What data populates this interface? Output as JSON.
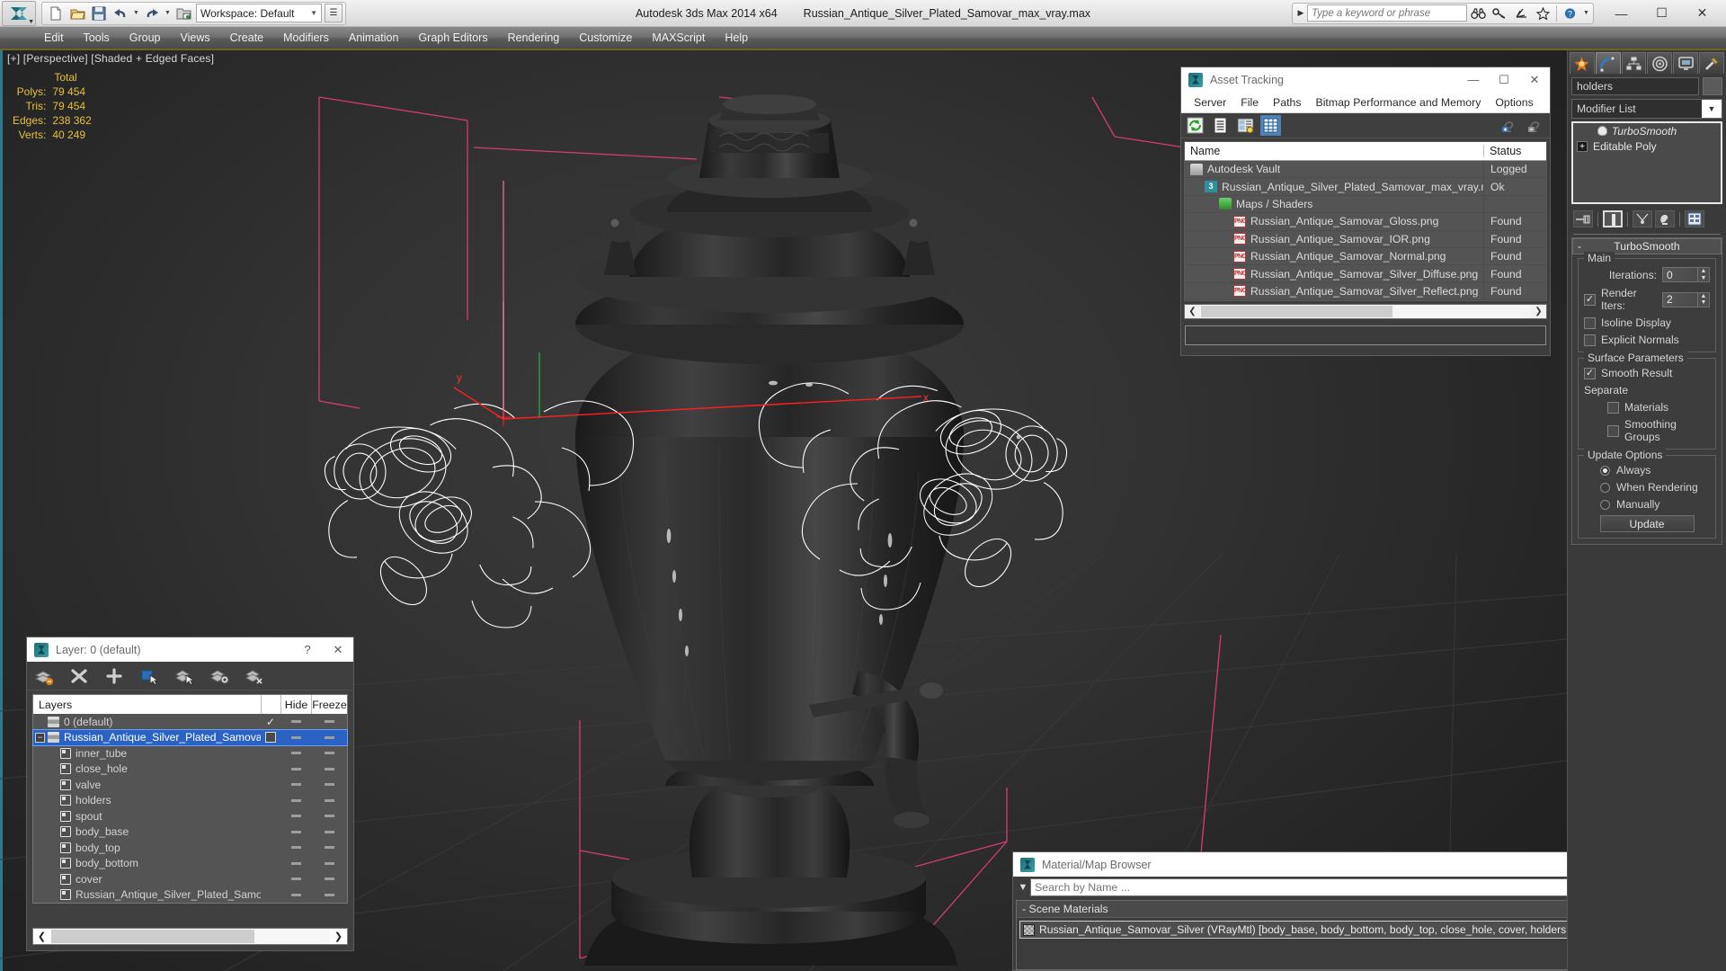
{
  "app": {
    "title": "Autodesk 3ds Max  2014 x64",
    "file_title": "Russian_Antique_Silver_Plated_Samovar_max_vray.max",
    "workspace_label": "Workspace: Default"
  },
  "quick_access": {
    "items": [
      {
        "name": "new-file-icon",
        "glyph": "new"
      },
      {
        "name": "open-file-icon",
        "glyph": "open"
      },
      {
        "name": "save-file-icon",
        "glyph": "save"
      },
      {
        "name": "undo-icon",
        "glyph": "undo"
      },
      {
        "name": "redo-icon",
        "glyph": "redo"
      },
      {
        "name": "set-project-folder-icon",
        "glyph": "project"
      }
    ]
  },
  "infocenter": {
    "placeholder": "Type a keyword or phrase",
    "icons": [
      "binoculars-icon",
      "key-icon",
      "subscription-icon",
      "favorites-star-icon",
      "help-icon"
    ]
  },
  "window_controls": {
    "minimize": "—",
    "maximize": "☐",
    "close": "✕"
  },
  "menubar": {
    "items": [
      "Edit",
      "Tools",
      "Group",
      "Views",
      "Create",
      "Modifiers",
      "Animation",
      "Graph Editors",
      "Rendering",
      "Customize",
      "MAXScript",
      "Help"
    ]
  },
  "viewport": {
    "label": "[+] [Perspective] [Shaded + Edged Faces]",
    "stats": {
      "header": "Total",
      "rows": [
        {
          "label": "Polys:",
          "value": "79 454"
        },
        {
          "label": "Tris:",
          "value": "79 454"
        },
        {
          "label": "Edges:",
          "value": "238 362"
        },
        {
          "label": "Verts:",
          "value": "40 249"
        }
      ]
    },
    "axis": {
      "x": "x",
      "y": "y"
    },
    "colors": {
      "stats_text": "#e3c13c",
      "grid_line": "#d63b77",
      "wireframe": "#ffffff",
      "axis_x": "#ff2020",
      "axis_y": "#30d030",
      "axis_z": "#ff7ab0"
    }
  },
  "asset_tracking": {
    "title": "Asset Tracking",
    "menu": [
      "Server",
      "File",
      "Paths",
      "Bitmap Performance and Memory",
      "Options"
    ],
    "toolbar_icons": [
      "refresh-icon",
      "list-view-icon",
      "details-view-icon",
      "grid-view-icon"
    ],
    "toolbar_right_icons": [
      "add-help-icon",
      "remove-help-icon"
    ],
    "columns": [
      "Name",
      "Status"
    ],
    "rows": [
      {
        "name": "Autodesk Vault",
        "status": "Logged",
        "icon": "vault-icon",
        "indent": 1
      },
      {
        "name": "Russian_Antique_Silver_Plated_Samovar_max_vray.max",
        "status": "Ok",
        "icon": "max-file-icon",
        "indent": 2
      },
      {
        "name": "Maps / Shaders",
        "status": "",
        "icon": "maps-folder-icon",
        "indent": 3
      },
      {
        "name": "Russian_Antique_Samovar_Gloss.png",
        "status": "Found",
        "icon": "png-icon",
        "indent": 4
      },
      {
        "name": "Russian_Antique_Samovar_IOR.png",
        "status": "Found",
        "icon": "png-icon",
        "indent": 4
      },
      {
        "name": "Russian_Antique_Samovar_Normal.png",
        "status": "Found",
        "icon": "png-icon",
        "indent": 4
      },
      {
        "name": "Russian_Antique_Samovar_Silver_Diffuse.png",
        "status": "Found",
        "icon": "png-icon",
        "indent": 4
      },
      {
        "name": "Russian_Antique_Samovar_Silver_Reflect.png",
        "status": "Found",
        "icon": "png-icon",
        "indent": 4
      }
    ],
    "path_field_value": ""
  },
  "layer_window": {
    "title": "Layer: 0 (default)",
    "help_label": "?",
    "close_label": "✕",
    "toolbar_icons": [
      "new-layer-icon",
      "delete-layer-icon",
      "add-layer-icon",
      "select-objects-icon",
      "select-highlighted-icon",
      "highlight-selected-icon",
      "hide-layer-icon"
    ],
    "columns": {
      "layers": "Layers",
      "hide": "Hide",
      "freeze": "Freeze"
    },
    "rows": [
      {
        "name": "0 (default)",
        "type": "layer",
        "indent": 1,
        "selected": false,
        "current": true,
        "expander": false
      },
      {
        "name": "Russian_Antique_Silver_Plated_Samovar",
        "type": "layer",
        "indent": 1,
        "selected": true,
        "current": false,
        "expander": true
      },
      {
        "name": "inner_tube",
        "type": "object",
        "indent": 2,
        "selected": false,
        "current": false,
        "expander": false
      },
      {
        "name": "close_hole",
        "type": "object",
        "indent": 2,
        "selected": false,
        "current": false,
        "expander": false
      },
      {
        "name": "valve",
        "type": "object",
        "indent": 2,
        "selected": false,
        "current": false,
        "expander": false
      },
      {
        "name": "holders",
        "type": "object",
        "indent": 2,
        "selected": false,
        "current": false,
        "expander": false
      },
      {
        "name": "spout",
        "type": "object",
        "indent": 2,
        "selected": false,
        "current": false,
        "expander": false
      },
      {
        "name": "body_base",
        "type": "object",
        "indent": 2,
        "selected": false,
        "current": false,
        "expander": false
      },
      {
        "name": "body_top",
        "type": "object",
        "indent": 2,
        "selected": false,
        "current": false,
        "expander": false
      },
      {
        "name": "body_bottom",
        "type": "object",
        "indent": 2,
        "selected": false,
        "current": false,
        "expander": false
      },
      {
        "name": "cover",
        "type": "object",
        "indent": 2,
        "selected": false,
        "current": false,
        "expander": false
      },
      {
        "name": "Russian_Antique_Silver_Plated_Samovar",
        "type": "object",
        "indent": 2,
        "selected": false,
        "current": false,
        "expander": false
      }
    ]
  },
  "material_browser": {
    "title": "Material/Map Browser",
    "close_label": "✕",
    "search_placeholder": "Search by Name ...",
    "search_value": "",
    "group_label": "- Scene Materials",
    "items": [
      {
        "label": "Russian_Antique_Samovar_Silver (VRayMtl) [body_base, body_bottom, body_top, close_hole, cover, holders, inner_tube, spout, valve]"
      }
    ]
  },
  "command_panel": {
    "tabs": [
      {
        "name": "create-tab",
        "icon": "star-icon",
        "active": false
      },
      {
        "name": "modify-tab",
        "icon": "curve-icon",
        "active": true
      },
      {
        "name": "hierarchy-tab",
        "icon": "hierarchy-icon",
        "active": false
      },
      {
        "name": "motion-tab",
        "icon": "wheel-icon",
        "active": false
      },
      {
        "name": "display-tab",
        "icon": "monitor-icon",
        "active": false
      },
      {
        "name": "utilities-tab",
        "icon": "hammer-icon",
        "active": false
      }
    ],
    "object_name": "holders",
    "modifier_list_label": "Modifier List",
    "stack": [
      {
        "label": "TurboSmooth",
        "icon": "lightbulb-icon",
        "italic": true
      },
      {
        "label": "Editable Poly",
        "icon": "plus-box-icon",
        "italic": false
      }
    ],
    "stack_buttons": [
      "pin-stack-icon",
      "show-end-result-icon",
      "make-unique-icon",
      "remove-modifier-icon",
      "configure-sets-icon"
    ],
    "rollout": {
      "title": "TurboSmooth",
      "collapse_glyph": "-",
      "groups": [
        {
          "title": "Main",
          "fields": [
            {
              "type": "spinner",
              "label": "Iterations:",
              "value": "0"
            },
            {
              "type": "checkbox_spinner",
              "label": "Render Iters:",
              "value": "2",
              "checked": true
            },
            {
              "type": "checkbox",
              "label": "Isoline Display",
              "checked": false
            },
            {
              "type": "checkbox",
              "label": "Explicit Normals",
              "checked": false
            }
          ]
        },
        {
          "title": "Surface Parameters",
          "fields": [
            {
              "type": "checkbox",
              "label": "Smooth Result",
              "checked": true
            },
            {
              "type": "text",
              "label": "Separate"
            },
            {
              "type": "checkbox_indent",
              "label": "Materials",
              "checked": false
            },
            {
              "type": "checkbox_indent",
              "label": "Smoothing Groups",
              "checked": false
            }
          ]
        },
        {
          "title": "Update Options",
          "fields": [
            {
              "type": "radio",
              "label": "Always",
              "checked": true
            },
            {
              "type": "radio",
              "label": "When Rendering",
              "checked": false
            },
            {
              "type": "radio",
              "label": "Manually",
              "checked": false
            },
            {
              "type": "button",
              "label": "Update"
            }
          ]
        }
      ]
    }
  }
}
